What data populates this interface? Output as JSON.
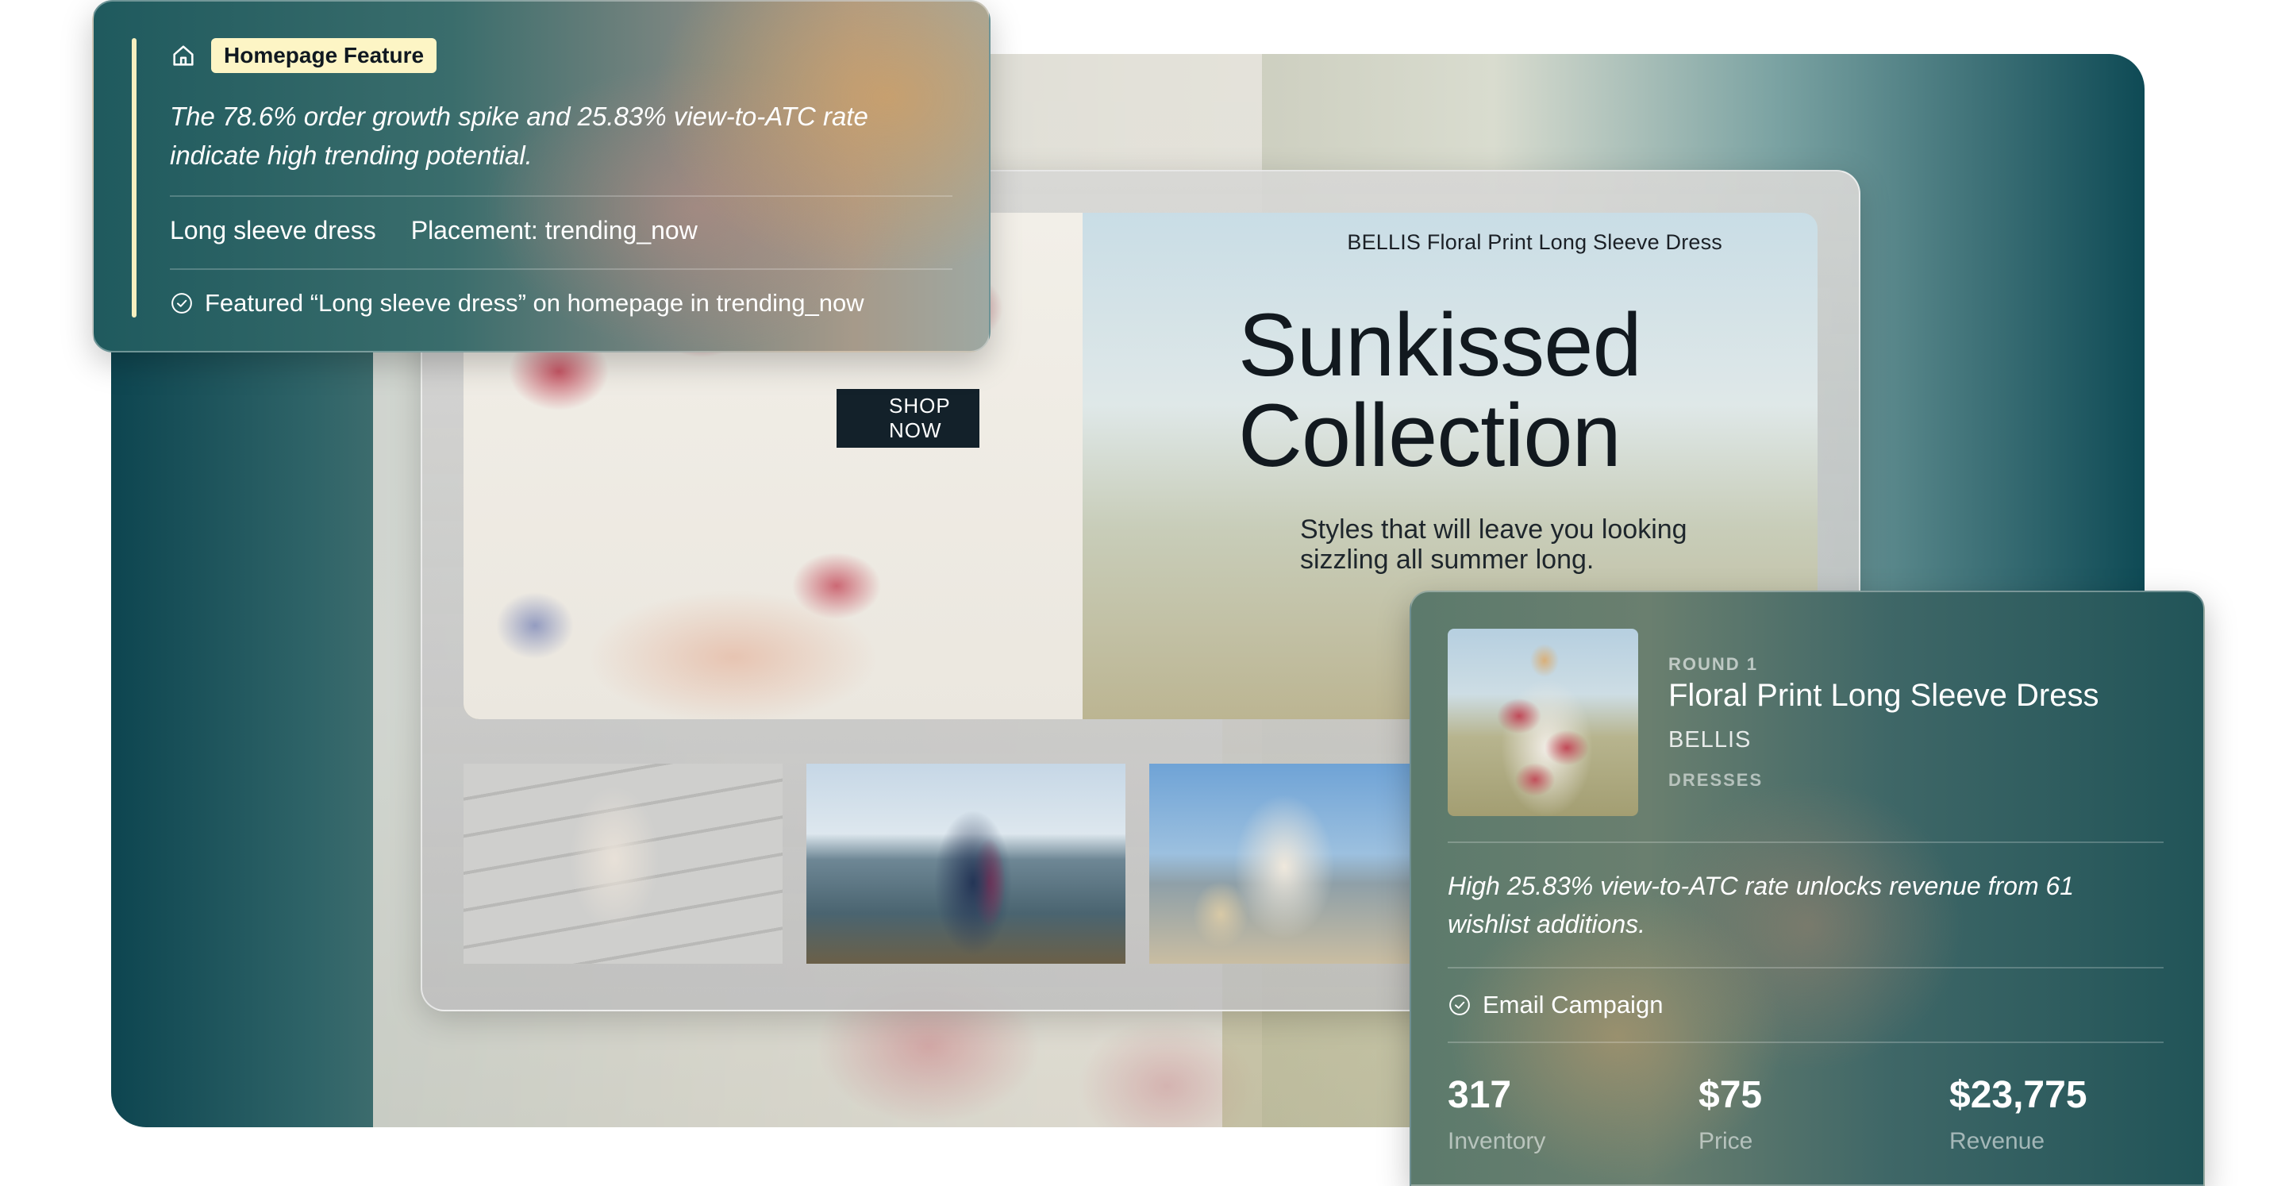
{
  "feature_card": {
    "tag": "Homepage Feature",
    "quote": "The 78.6% order growth spike and 25.83% view-to-ATC rate indicate high trending potential.",
    "product_type": "Long sleeve dress",
    "placement": "Placement: trending_now",
    "status": "Featured “Long sleeve dress” on homepage in trending_now",
    "icons": {
      "head": "home-icon",
      "status": "check-circle-icon"
    }
  },
  "storefront": {
    "product_name": "BELLIS Floral Print Long Sleeve Dress",
    "headline_line1": "Sunkissed",
    "headline_line2": "Collection",
    "subtitle": "Styles that will leave you looking sizzling all summer long.",
    "shop_button": "SHOP NOW",
    "thumbnails": [
      "thumbnail-1",
      "thumbnail-2",
      "thumbnail-3"
    ]
  },
  "product_card": {
    "round": "ROUND 1",
    "title": "Floral Print Long Sleeve Dress",
    "brand": "BELLIS",
    "category": "DRESSES",
    "quote": "High 25.83% view-to-ATC rate unlocks revenue from 61 wishlist additions.",
    "action": "Email Campaign",
    "stats": [
      {
        "value": "317",
        "label": "Inventory"
      },
      {
        "value": "$75",
        "label": "Price"
      },
      {
        "value": "$23,775",
        "label": "Revenue"
      }
    ]
  },
  "colors": {
    "highlight": "#fdf5c5",
    "teal_dark": "#0d4550",
    "button_dark": "#13212a"
  }
}
